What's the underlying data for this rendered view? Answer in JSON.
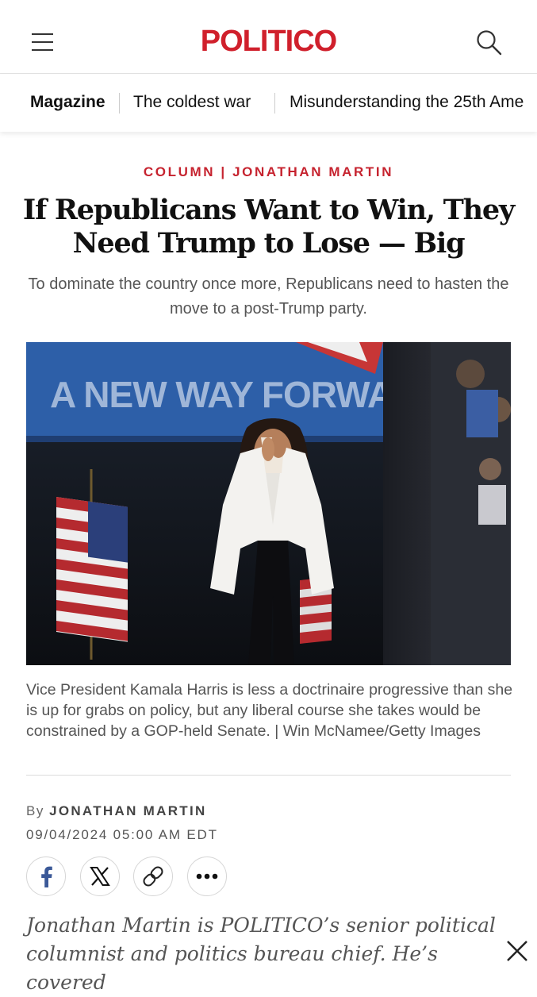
{
  "header": {
    "logo": "POLITICO"
  },
  "topics": [
    {
      "label": "Magazine"
    },
    {
      "label": "The coldest war"
    },
    {
      "label": "Misunderstanding the 25th Ame"
    }
  ],
  "article": {
    "kicker": "COLUMN | JONATHAN MARTIN",
    "headline": "If Republicans Want to Win, They Need Trump to Lose — Big",
    "dek": "To dominate the country once more, Republicans need to hasten the move to a post-Trump party.",
    "photo": {
      "banner_text": "A NEW WAY FORWARD"
    },
    "caption": "Vice President Kamala Harris is less a doctrinaire progressive than she is up for grabs on policy, but any liberal course she takes would be constrained by a GOP-held Senate. | Win McNamee/Getty Images",
    "byline_prefix": "By",
    "author": "JONATHAN MARTIN",
    "date": "09/04/2024 05:00 AM EDT",
    "intro": "Jonathan Martin is POLITICO’s senior political columnist and politics bureau chief. He’s covered"
  },
  "share": {
    "icons": [
      "facebook-icon",
      "x-icon",
      "link-icon",
      "more-icon"
    ]
  },
  "colors": {
    "brand_red": "#d0202c",
    "kicker_red": "#c6232f"
  }
}
